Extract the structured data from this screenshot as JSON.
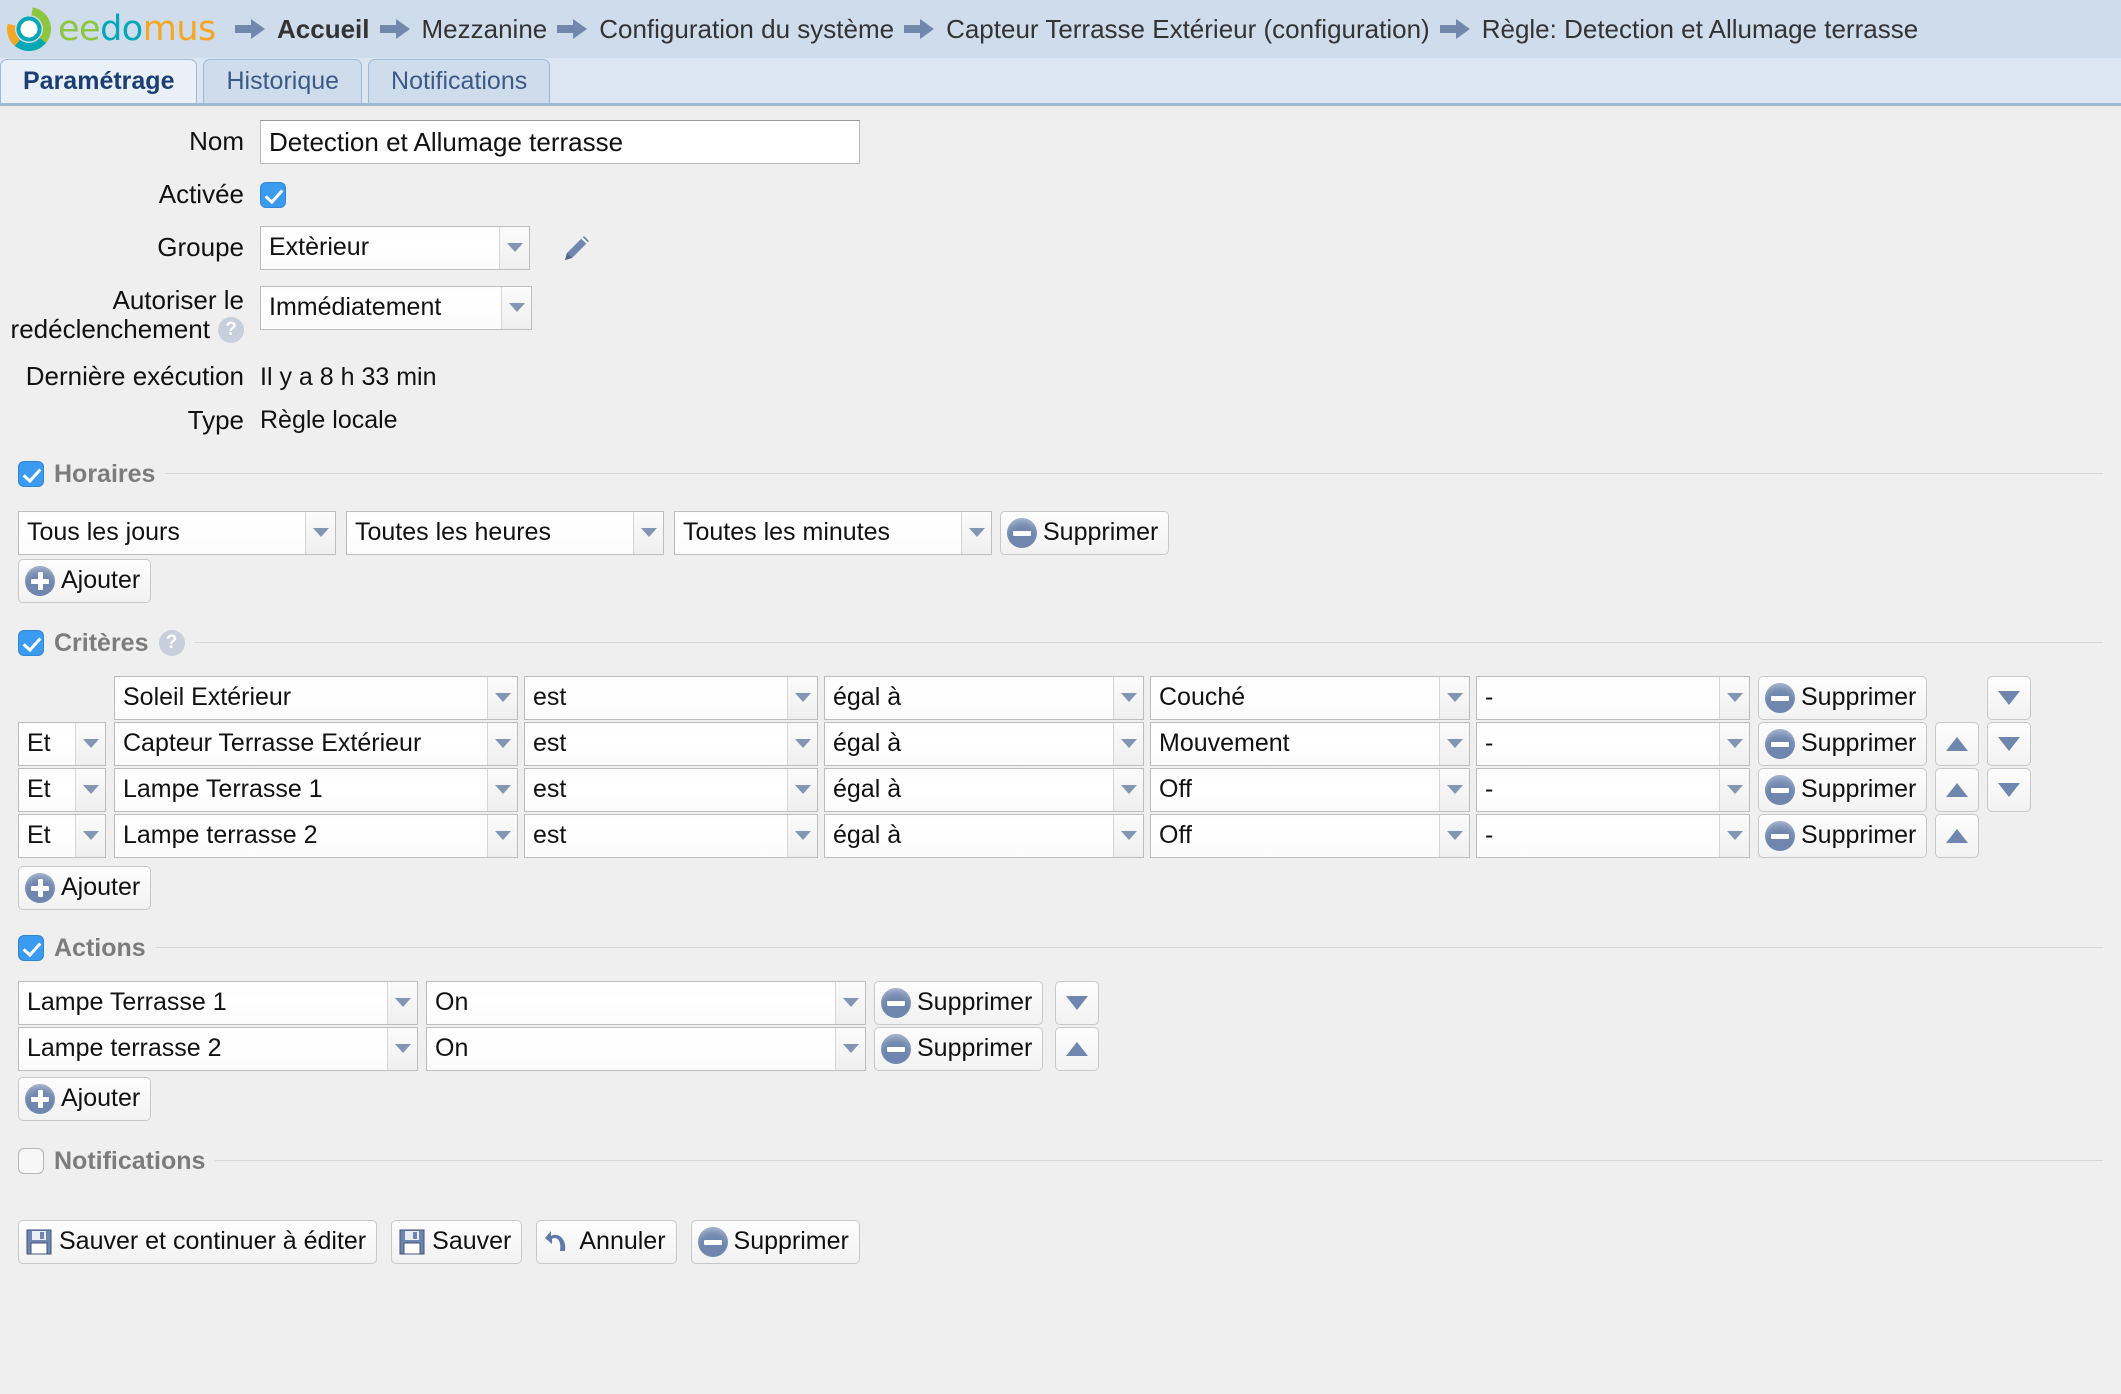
{
  "brand": {
    "name_part1": "ee",
    "name_part2": "do",
    "name_part3": "mus"
  },
  "breadcrumbs": [
    {
      "label": "Accueil",
      "bold": true
    },
    {
      "label": "Mezzanine",
      "bold": false
    },
    {
      "label": "Configuration du système",
      "bold": false
    },
    {
      "label": "Capteur Terrasse Extérieur (configuration)",
      "bold": false
    },
    {
      "label": "Règle: Detection et Allumage terrasse",
      "bold": false
    }
  ],
  "tabs": [
    {
      "label": "Paramétrage",
      "active": true
    },
    {
      "label": "Historique",
      "active": false
    },
    {
      "label": "Notifications",
      "active": false
    }
  ],
  "form": {
    "nom_label": "Nom",
    "nom_value": "Detection et Allumage terrasse",
    "activee_label": "Activée",
    "activee_checked": true,
    "groupe_label": "Groupe",
    "groupe_value": "Extèrieur",
    "redecl_label_line1": "Autoriser le",
    "redecl_label_line2": "redéclenchement",
    "redecl_value": "Immédiatement",
    "derniere_label": "Dernière exécution",
    "derniere_value": "Il y a 8 h 33 min",
    "type_label": "Type",
    "type_value": "Règle locale"
  },
  "horaires": {
    "legend": "Horaires",
    "checked": true,
    "rows": [
      {
        "jours": "Tous les jours",
        "heures": "Toutes les heures",
        "minutes": "Toutes les minutes",
        "delete_label": "Supprimer"
      }
    ],
    "add_label": "Ajouter"
  },
  "criteres": {
    "legend": "Critères",
    "checked": true,
    "help": "?",
    "add_label": "Ajouter",
    "delete_label": "Supprimer",
    "rows": [
      {
        "logic": "",
        "device": "Soleil Extérieur",
        "verb": "est",
        "comparator": "égal à",
        "value": "Couché",
        "extra": "-",
        "up": false,
        "down": true
      },
      {
        "logic": "Et",
        "device": "Capteur Terrasse Extérieur",
        "verb": "est",
        "comparator": "égal à",
        "value": "Mouvement",
        "extra": "-",
        "up": true,
        "down": true
      },
      {
        "logic": "Et",
        "device": "Lampe Terrasse 1",
        "verb": "est",
        "comparator": "égal à",
        "value": "Off",
        "extra": "-",
        "up": true,
        "down": true
      },
      {
        "logic": "Et",
        "device": "Lampe terrasse 2",
        "verb": "est",
        "comparator": "égal à",
        "value": "Off",
        "extra": "-",
        "up": true,
        "down": false
      }
    ]
  },
  "actions": {
    "legend": "Actions",
    "checked": true,
    "add_label": "Ajouter",
    "delete_label": "Supprimer",
    "rows": [
      {
        "device": "Lampe Terrasse 1",
        "state": "On",
        "up": false,
        "down": true
      },
      {
        "device": "Lampe terrasse 2",
        "state": "On",
        "up": true,
        "down": false
      }
    ]
  },
  "notifications": {
    "legend": "Notifications",
    "checked": false
  },
  "footer": {
    "save_continue_label": "Sauver et continuer à éditer",
    "save_label": "Sauver",
    "cancel_label": "Annuler",
    "delete_label": "Supprimer"
  },
  "colors": {
    "header_bg": "#cfdcec",
    "tab_active_text": "#1c3f73",
    "checkbox_blue": "#3b9bf0",
    "icon_blue_gray": "#6f86ae",
    "logo_green": "#8cc63e",
    "logo_teal": "#00a7b5",
    "logo_orange": "#f5a623"
  }
}
